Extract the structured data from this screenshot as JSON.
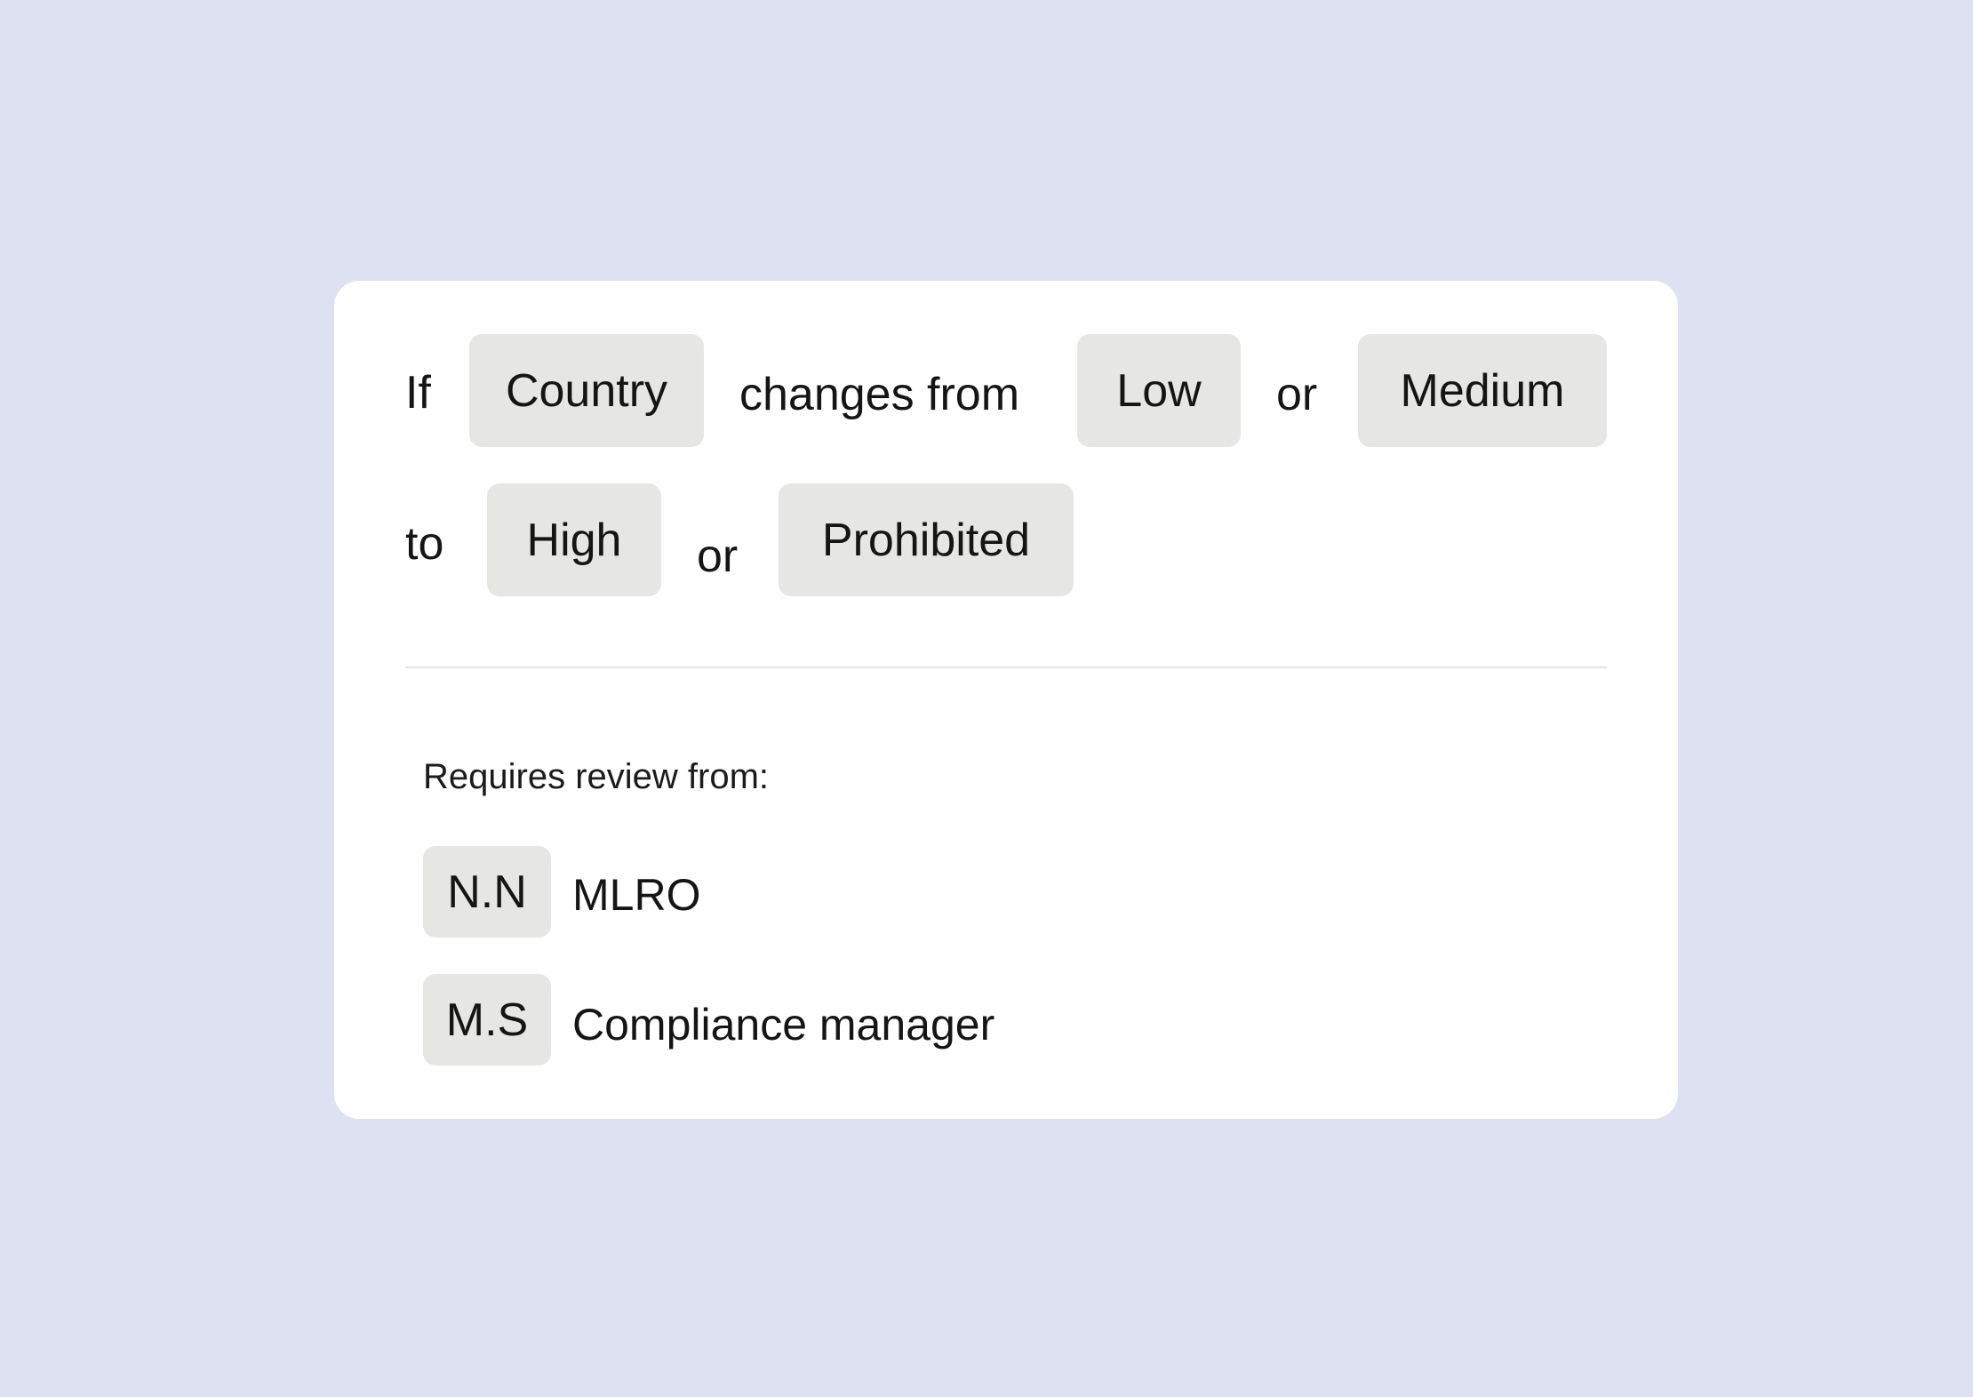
{
  "rule": {
    "if_word": "If",
    "field_chip": "Country",
    "changes_from_text": "changes from",
    "from_values": [
      "Low",
      "Medium"
    ],
    "or_word": "or",
    "to_word": "to",
    "to_values": [
      "High",
      "Prohibited"
    ]
  },
  "review": {
    "label": "Requires review from:",
    "reviewers": [
      {
        "initials": "N.N",
        "role": "MLRO"
      },
      {
        "initials": "M.S",
        "role": "Compliance manager"
      }
    ]
  }
}
